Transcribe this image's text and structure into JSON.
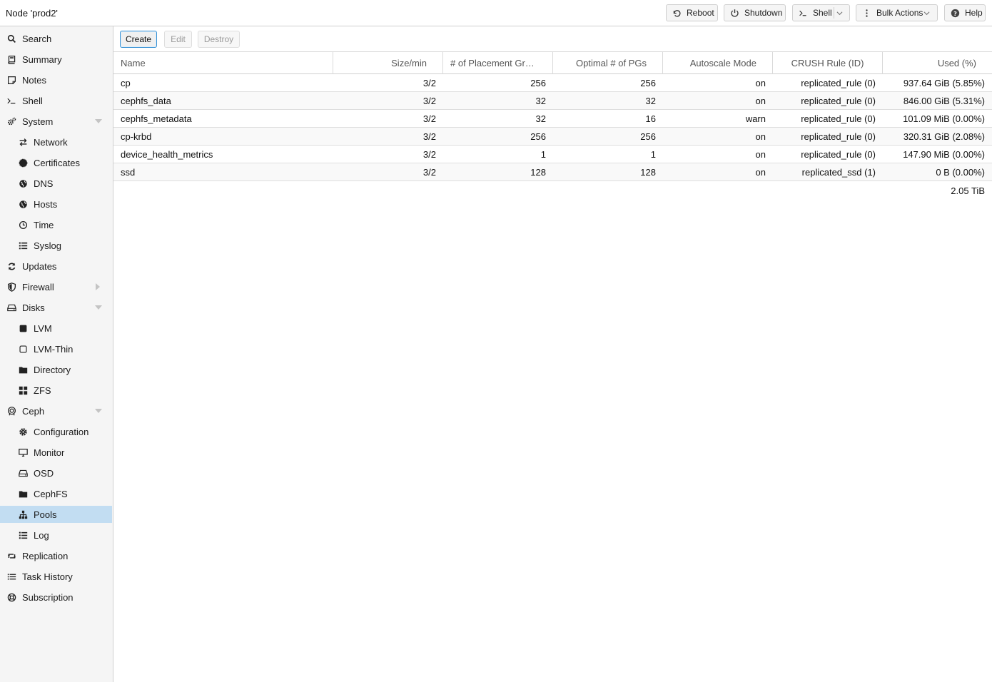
{
  "header": {
    "title": "Node 'prod2'",
    "buttons": {
      "reboot": "Reboot",
      "shutdown": "Shutdown",
      "shell": "Shell",
      "bulk_actions": "Bulk Actions",
      "help": "Help"
    }
  },
  "sidebar": {
    "items": [
      {
        "label": "Search",
        "icon": "search-icon"
      },
      {
        "label": "Summary",
        "icon": "book-icon"
      },
      {
        "label": "Notes",
        "icon": "note-icon"
      },
      {
        "label": "Shell",
        "icon": "terminal-icon"
      },
      {
        "label": "System",
        "icon": "cogs-icon",
        "expanded": true
      },
      {
        "label": "Network",
        "icon": "exchange-icon"
      },
      {
        "label": "Certificates",
        "icon": "certificate-icon"
      },
      {
        "label": "DNS",
        "icon": "globe-icon"
      },
      {
        "label": "Hosts",
        "icon": "globe-icon"
      },
      {
        "label": "Time",
        "icon": "clock-icon"
      },
      {
        "label": "Syslog",
        "icon": "list-icon"
      },
      {
        "label": "Updates",
        "icon": "refresh-icon"
      },
      {
        "label": "Firewall",
        "icon": "shield-icon",
        "expanded": false
      },
      {
        "label": "Disks",
        "icon": "hdd-icon",
        "expanded": true
      },
      {
        "label": "LVM",
        "icon": "square-icon"
      },
      {
        "label": "LVM-Thin",
        "icon": "square-outline-icon"
      },
      {
        "label": "Directory",
        "icon": "folder-icon"
      },
      {
        "label": "ZFS",
        "icon": "th-large-icon"
      },
      {
        "label": "Ceph",
        "icon": "ceph-icon",
        "expanded": true
      },
      {
        "label": "Configuration",
        "icon": "gear-icon"
      },
      {
        "label": "Monitor",
        "icon": "desktop-icon"
      },
      {
        "label": "OSD",
        "icon": "hdd-icon"
      },
      {
        "label": "CephFS",
        "icon": "folder-icon"
      },
      {
        "label": "Pools",
        "icon": "sitemap-icon",
        "selected": true
      },
      {
        "label": "Log",
        "icon": "list-icon"
      },
      {
        "label": "Replication",
        "icon": "retweet-icon"
      },
      {
        "label": "Task History",
        "icon": "list-alt-icon"
      },
      {
        "label": "Subscription",
        "icon": "support-icon"
      }
    ]
  },
  "toolbar": {
    "create": "Create",
    "edit": "Edit",
    "destroy": "Destroy"
  },
  "table": {
    "columns": [
      "Name",
      "Size/min",
      "# of Placement Gr…",
      "Optimal # of PGs",
      "Autoscale Mode",
      "CRUSH Rule (ID)",
      "Used (%)"
    ],
    "rows": [
      [
        "cp",
        "3/2",
        "256",
        "256",
        "on",
        "replicated_rule (0)",
        "937.64 GiB (5.85%)"
      ],
      [
        "cephfs_data",
        "3/2",
        "32",
        "32",
        "on",
        "replicated_rule (0)",
        "846.00 GiB (5.31%)"
      ],
      [
        "cephfs_metadata",
        "3/2",
        "32",
        "16",
        "warn",
        "replicated_rule (0)",
        "101.09 MiB (0.00%)"
      ],
      [
        "cp-krbd",
        "3/2",
        "256",
        "256",
        "on",
        "replicated_rule (0)",
        "320.31 GiB (2.08%)"
      ],
      [
        "device_health_metrics",
        "3/2",
        "1",
        "1",
        "on",
        "replicated_rule (0)",
        "147.90 MiB (0.00%)"
      ],
      [
        "ssd",
        "3/2",
        "128",
        "128",
        "on",
        "replicated_ssd (1)",
        "0 B (0.00%)"
      ]
    ],
    "total": "2.05 TiB"
  },
  "colors": {
    "selected_bg": "#c2ddf2",
    "primary_border": "#3892d4"
  }
}
